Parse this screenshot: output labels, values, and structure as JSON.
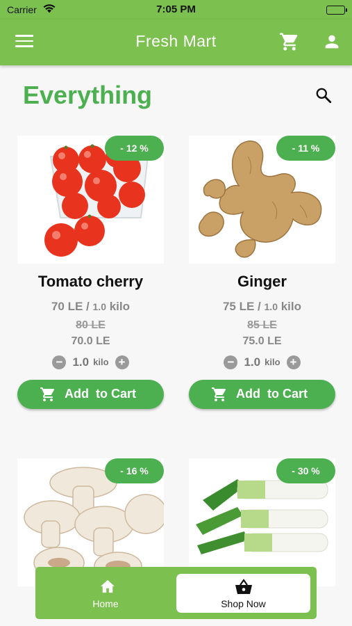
{
  "status_bar": {
    "carrier": "Carrier",
    "time": "7:05 PM"
  },
  "app_bar": {
    "title": "Fresh Mart",
    "icons": [
      "menu-icon",
      "cart-icon",
      "user-icon"
    ]
  },
  "page": {
    "heading": "Everything",
    "search_icon": "search-icon"
  },
  "colors": {
    "brand_green": "#7cc04f",
    "accent_green": "#4caf50"
  },
  "products": [
    {
      "name": "Tomato cherry",
      "discount": "- 12 %",
      "price": "70 LE /",
      "unit_qty": "1.0",
      "unit": "kilo",
      "old_price": "80 LE",
      "new_price": "70.0 LE",
      "quantity": "1.0",
      "qty_unit": "kilo",
      "add_label": "Add  to Cart"
    },
    {
      "name": "Ginger",
      "discount": "- 11 %",
      "price": "75 LE /",
      "unit_qty": "1.0",
      "unit": "kilo",
      "old_price": "85 LE",
      "new_price": "75.0 LE",
      "quantity": "1.0",
      "qty_unit": "kilo",
      "add_label": "Add  to Cart"
    },
    {
      "discount": "- 16 %"
    },
    {
      "discount": "- 30 %"
    }
  ],
  "bottom_nav": {
    "home_label": "Home",
    "shop_label": "Shop Now",
    "selected": "Shop Now"
  }
}
